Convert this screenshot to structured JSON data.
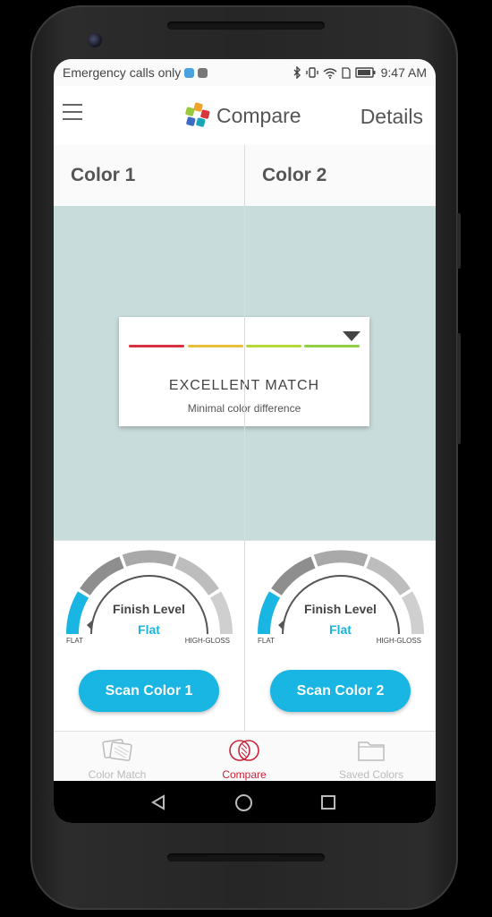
{
  "status_bar": {
    "carrier": "Emergency calls only",
    "time": "9:47 AM"
  },
  "app_bar": {
    "title": "Compare",
    "details_label": "Details"
  },
  "columns": [
    {
      "label": "Color 1",
      "finish_title": "Finish Level",
      "finish_value": "Flat",
      "finish_min": "FLAT",
      "finish_max": "HIGH-GLOSS",
      "scan_label": "Scan Color 1"
    },
    {
      "label": "Color 2",
      "finish_title": "Finish Level",
      "finish_value": "Flat",
      "finish_min": "FLAT",
      "finish_max": "HIGH-GLOSS",
      "scan_label": "Scan Color 2"
    }
  ],
  "match": {
    "title": "EXCELLENT MATCH",
    "subtitle": "Minimal color difference",
    "scale_colors": [
      "#d7323f",
      "#e8c03c",
      "#b6d93b",
      "#8fd143"
    ]
  },
  "swatch_color": "#c8dcdb",
  "accent_color": "#19b5e3",
  "bottom_nav": {
    "items": [
      {
        "label": "Color Match",
        "icon": "color-cards-icon",
        "active": false
      },
      {
        "label": "Compare",
        "icon": "compare-circles-icon",
        "active": true
      },
      {
        "label": "Saved Colors",
        "icon": "folder-icon",
        "active": false
      }
    ]
  },
  "system_nav": {
    "icons": [
      "back-icon",
      "home-icon",
      "recents-icon"
    ]
  }
}
